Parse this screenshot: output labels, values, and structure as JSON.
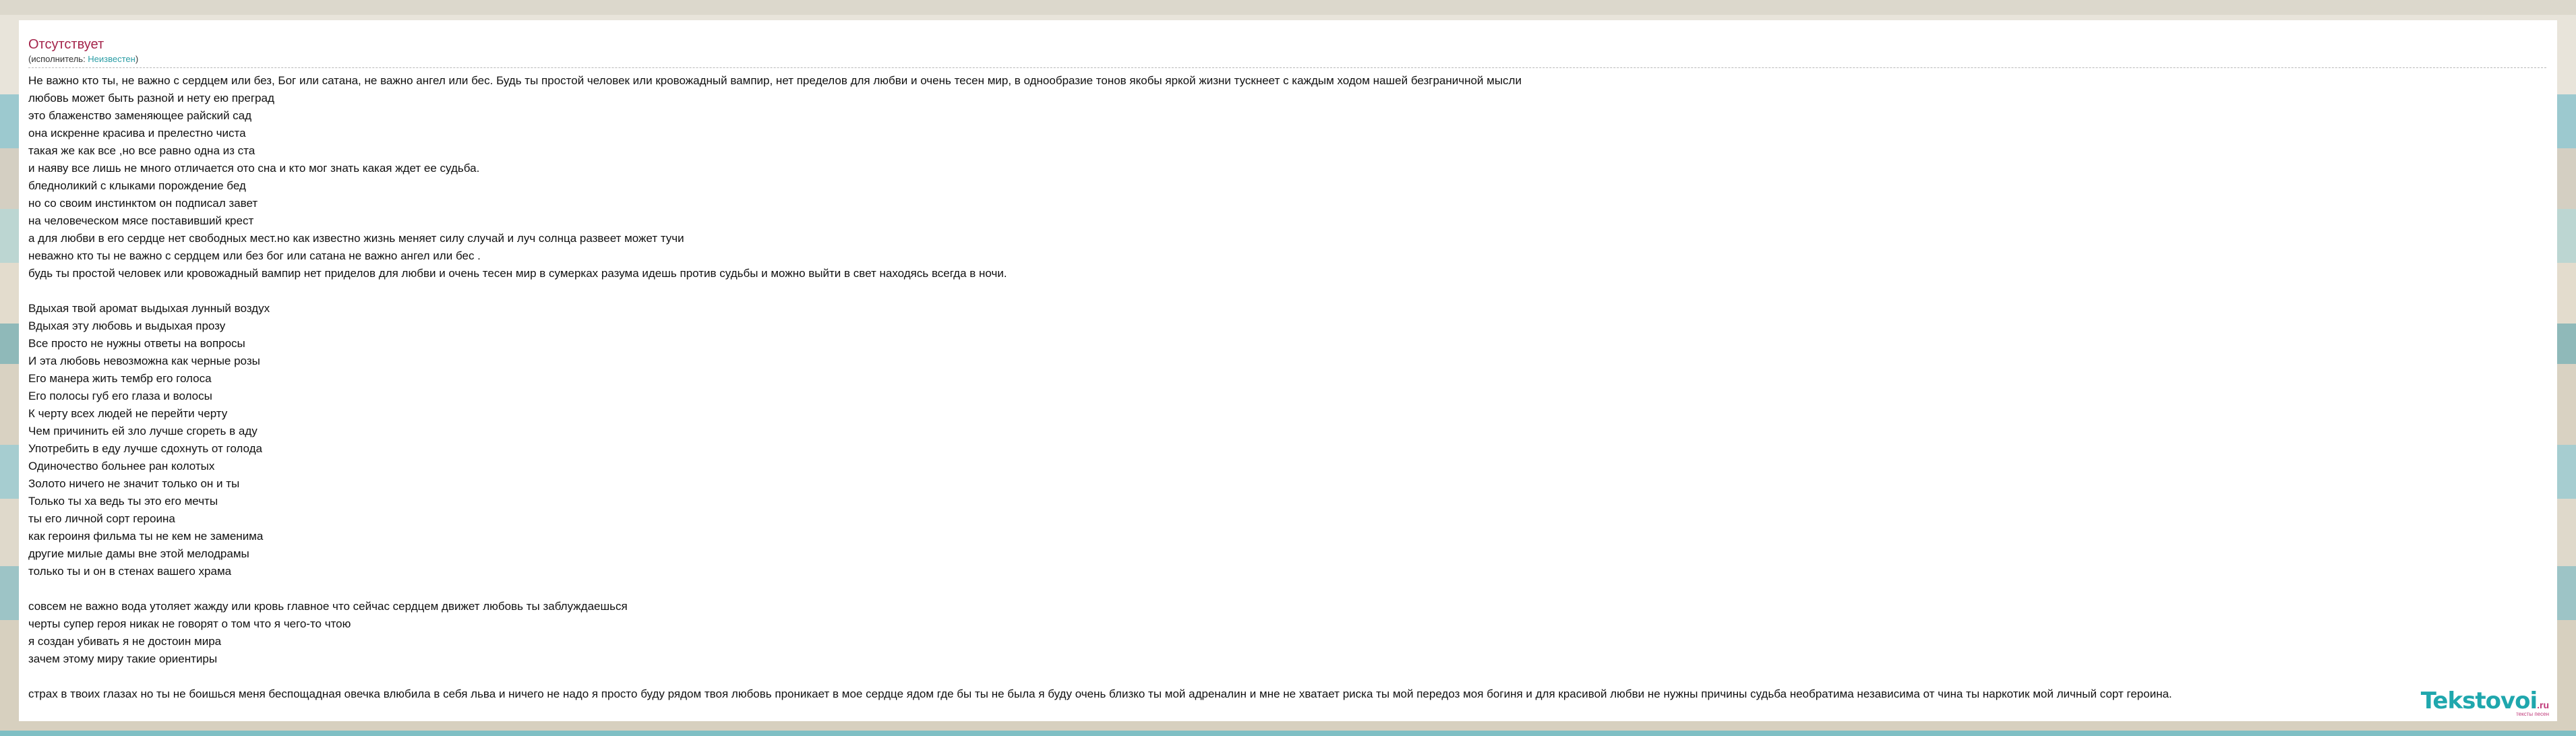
{
  "song": {
    "title": "Отсутствует",
    "performer_prefix": "(исполнитель: ",
    "performer_name": "Неизвестен",
    "performer_suffix": ")"
  },
  "lyrics": [
    "Не важно кто ты, не важно с сердцем или без, Бог или сатана, не важно ангел или бес. Будь ты простой человек или кровожадный вампир, нет пределов для любви и очень тесен мир, в однообразие тонов якобы яркой жизни тускнеет с каждым ходом нашей безграничной мысли",
    "любовь может быть разной и нету ею преград",
    "это блаженство заменяющее райский сад",
    "она искренне красива и прелестно чиста",
    "такая же как все ,но все равно одна из ста",
    "и наяву все лишь не много отличается ото сна и кто мог знать какая ждет ее судьба.",
    "бледноликий с клыками порождение бед",
    "но со своим инстинктом он подписал завет",
    "на человеческом мясе поставивший крест",
    "а для любви в его сердце нет свободных мест.но как известно жизнь меняет силу случай и луч солнца развеет может тучи",
    "неважно кто ты не важно с сердцем или без бог или сатана не важно ангел или бес .",
    "будь ты простой человек или кровожадный вампир нет приделов для любви и очень тесен мир в сумерках разума идешь против судьбы и можно выйти в свет находясь всегда в ночи.",
    "",
    "Вдыхая твой аромат выдыхая лунный воздух",
    "Вдыхая эту любовь и выдыхая прозу",
    "Все просто не нужны ответы на вопросы",
    "И эта любовь невозможна как черные розы",
    "Его манера жить тембр его голоса",
    "Его полосы губ его глаза и волосы",
    "К черту всех людей не перейти черту",
    "Чем причинить ей зло лучше сгореть в аду",
    "Употребить в еду лучше сдохнуть от голода",
    "Одиночество больнее ран колотых",
    "Золото ничего не значит только он и ты",
    "Только ты ха ведь ты это его мечты",
    "ты его личной сорт героина",
    "как героиня фильма ты не кем не заменима",
    "другие милые дамы вне этой мелодрамы",
    "только ты и он в стенах вашего храма",
    "",
    "совсем не важно вода утоляет жажду или кровь главное что сейчас сердцем движет любовь ты заблуждаешься",
    "черты супер героя никак не говорят о том что я чего-то чтою",
    "я создан убивать я не достоин мира",
    "зачем этому миру такие ориентиры",
    "",
    "страх в твоих глазах но ты не боишься меня беспощадная овечка влюбила в себя льва и ничего не надо я просто буду рядом твоя любовь проникает в мое сердце ядом где бы ты не была я буду очень близко ты мой адреналин и мне не хватает риска ты мой передоз моя богиня и для красивой любви не нужны причины судьба необратима независима от чина ты наркотик мой личный сорт героина."
  ],
  "logo": {
    "main": "Tekstovoi",
    "domain": ".ru",
    "tagline": "тексты песен"
  },
  "colors": {
    "title": "#a4244a",
    "link": "#2a9da5",
    "logo": "#1fa7ad"
  }
}
